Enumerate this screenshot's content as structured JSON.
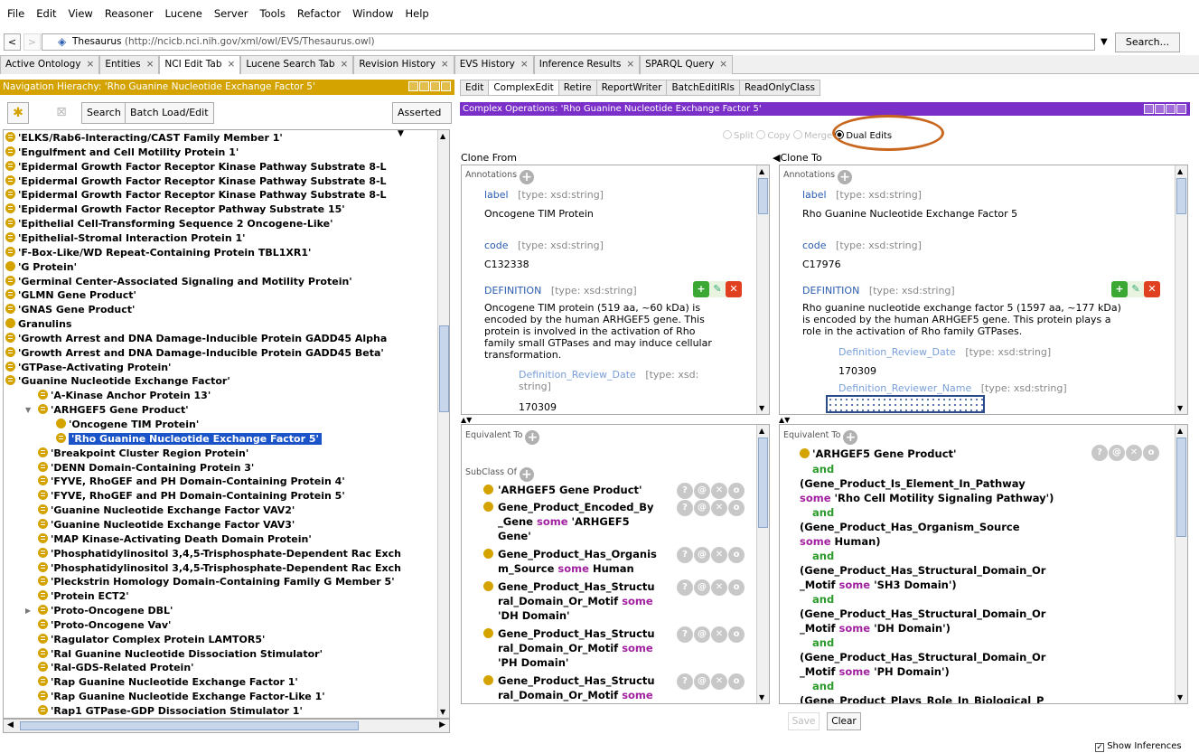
{
  "menu": [
    "File",
    "Edit",
    "View",
    "Reasoner",
    "Lucene",
    "Server",
    "Tools",
    "Refactor",
    "Window",
    "Help"
  ],
  "url": {
    "name": "Thesaurus",
    "address": "(http://ncicb.nci.nih.gov/xml/owl/EVS/Thesaurus.owl)",
    "search_label": "Search..."
  },
  "tabs": [
    "Active Ontology",
    "Entities",
    "NCI Edit Tab",
    "Lucene Search Tab",
    "Revision History",
    "EVS History",
    "Inference Results",
    "SPARQL Query"
  ],
  "active_tab": "NCI Edit Tab",
  "left": {
    "header": "Navigation Hierachy: 'Rho Guanine Nucleotide Exchange Factor 5'",
    "search_label": "Search",
    "batch_label": "Batch Load/Edit",
    "mode": "Asserted",
    "tree": [
      "'ELKS/Rab6-Interacting/CAST Family Member 1'",
      "'Engulfment and Cell Motility Protein 1'",
      "'Epidermal Growth Factor Receptor Kinase Pathway Substrate 8-L",
      "'Epidermal Growth Factor Receptor Kinase Pathway Substrate 8-L",
      "'Epidermal Growth Factor Receptor Kinase Pathway Substrate 8-L",
      "'Epidermal Growth Factor Receptor Pathway Substrate 15'",
      "'Epithelial Cell-Transforming Sequence 2 Oncogene-Like'",
      "'Epithelial-Stromal Interaction Protein 1'",
      "'F-Box-Like/WD Repeat-Containing Protein TBL1XR1'",
      "'G Protein'",
      "'Germinal Center-Associated Signaling and Motility Protein'",
      "'GLMN Gene Product'",
      "'GNAS Gene Product'",
      "Granulins",
      "'Growth Arrest and DNA Damage-Inducible Protein GADD45 Alpha",
      "'Growth Arrest and DNA Damage-Inducible Protein GADD45 Beta'",
      "'GTPase-Activating Protein'",
      "'Guanine Nucleotide Exchange Factor'",
      "'A-Kinase Anchor Protein 13'",
      "'ARHGEF5 Gene Product'",
      "'Oncogene TIM Protein'",
      "'Rho Guanine Nucleotide Exchange Factor 5'",
      "'Breakpoint Cluster Region Protein'",
      "'DENN Domain-Containing Protein 3'",
      "'FYVE, RhoGEF and PH Domain-Containing Protein 4'",
      "'FYVE, RhoGEF and PH Domain-Containing Protein 5'",
      "'Guanine Nucleotide Exchange Factor VAV2'",
      "'Guanine Nucleotide Exchange Factor VAV3'",
      "'MAP Kinase-Activating Death Domain Protein'",
      "'Phosphatidylinositol 3,4,5-Trisphosphate-Dependent Rac Exch",
      "'Phosphatidylinositol 3,4,5-Trisphosphate-Dependent Rac Exch",
      "'Pleckstrin Homology Domain-Containing Family G Member 5'",
      "'Protein ECT2'",
      "'Proto-Oncogene DBL'",
      "'Proto-Oncogene Vav'",
      "'Ragulator Complex Protein LAMTOR5'",
      "'Ral Guanine Nucleotide Dissociation Stimulator'",
      "'Ral-GDS-Related Protein'",
      "'Rap Guanine Nucleotide Exchange Factor 1'",
      "'Rap Guanine Nucleotide Exchange Factor-Like 1'",
      "'Rap1 GTPase-GDP Dissociation Stimulator 1'"
    ]
  },
  "right_tabs": [
    "Edit",
    "ComplexEdit",
    "Retire",
    "ReportWriter",
    "BatchEditIRIs",
    "ReadOnlyClass"
  ],
  "right_active_tab": "ComplexEdit",
  "complex_header": "Complex Operations: 'Rho Guanine Nucleotide Exchange Factor 5'",
  "radios": {
    "split": "Split",
    "copy": "Copy",
    "merge": "Merge",
    "dual": "Dual Edits"
  },
  "clone_from": {
    "title": "Clone From",
    "annotations_label": "Annotations",
    "label_prop": "label",
    "label_type": "[type: xsd:string]",
    "label_val": "Oncogene TIM Protein",
    "code_prop": "code",
    "code_type": "[type: xsd:string]",
    "code_val": "C132338",
    "def_prop": "DEFINITION",
    "def_type": "[type: xsd:string]",
    "def_lines": [
      "Oncogene TIM protein (519 aa, ~60 kDa) is",
      "encoded by the human ARHGEF5 gene. This",
      "protein is involved in the activation of Rho",
      "family small GTPases and may induce cellular",
      "transformation."
    ],
    "review_prop": "Definition_Review_Date",
    "review_type_a": "[type: xsd:",
    "review_type_b": "string]",
    "review_val": "170309",
    "equiv_label": "Equivalent To",
    "subclass_label": "SubClass Of",
    "subclass": [
      [
        "'ARHGEF5 Gene Product'"
      ],
      [
        "Gene_Product_Encoded_By",
        "_Gene some 'ARHGEF5",
        "Gene'"
      ],
      [
        "Gene_Product_Has_Organis",
        "m_Source some Human"
      ],
      [
        "Gene_Product_Has_Structu",
        "ral_Domain_Or_Motif some",
        "'DH Domain'"
      ],
      [
        "Gene_Product_Has_Structu",
        "ral_Domain_Or_Motif some",
        "'PH Domain'"
      ],
      [
        "Gene_Product_Has_Structu",
        "ral_Domain_Or_Motif some"
      ]
    ]
  },
  "clone_to": {
    "title": "Clone To",
    "annotations_label": "Annotations",
    "label_prop": "label",
    "label_type": "[type: xsd:string]",
    "label_val": "Rho Guanine Nucleotide Exchange Factor 5",
    "code_prop": "code",
    "code_type": "[type: xsd:string]",
    "code_val": "C17976",
    "def_prop": "DEFINITION",
    "def_type": "[type: xsd:string]",
    "def_lines": [
      "Rho guanine nucleotide exchange factor 5 (1597 aa, ~177 kDa)",
      "is encoded by the human ARHGEF5 gene. This protein plays a",
      "role in the activation of Rho family GTPases."
    ],
    "review_prop": "Definition_Review_Date",
    "review_type": "[type: xsd:string]",
    "review_val": "170309",
    "reviewer_prop": "Definition_Reviewer_Name",
    "reviewer_type": "[type: xsd:string]",
    "equiv_label": "Equivalent To",
    "equiv_head": "'ARHGEF5 Gene Product'",
    "equiv_lines": [
      "and",
      "(Gene_Product_Is_Element_In_Pathway",
      "some 'Rho Cell Motility Signaling Pathway')",
      "and",
      "(Gene_Product_Has_Organism_Source",
      "some Human)",
      "and",
      "(Gene_Product_Has_Structural_Domain_Or",
      "_Motif some 'SH3 Domain')",
      "and",
      "(Gene_Product_Has_Structural_Domain_Or",
      "_Motif some 'DH Domain')",
      "and",
      "(Gene_Product_Has_Structural_Domain_Or",
      "_Motif some 'PH Domain')",
      "and",
      "(Gene_Product_Plays_Role_In_Biological_P"
    ]
  },
  "save_label": "Save",
  "clear_label": "Clear",
  "show_inferences": "Show Inferences",
  "colors": {
    "nav_header": "#d4a300",
    "complex_header": "#7b2fc9",
    "selection": "#1a54c8",
    "highlight_ellipse": "#c9661e"
  }
}
